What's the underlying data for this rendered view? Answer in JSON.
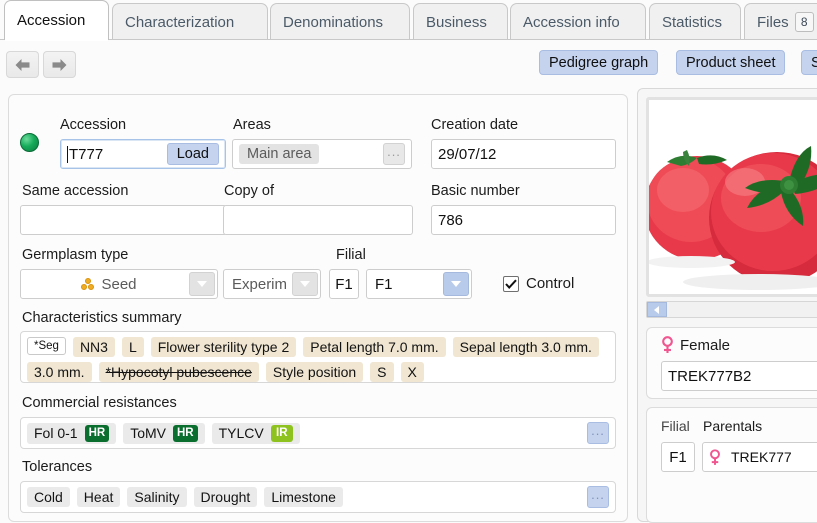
{
  "tabs": [
    {
      "label": "Accession",
      "active": true
    },
    {
      "label": "Characterization",
      "active": false
    },
    {
      "label": "Denominations",
      "active": false
    },
    {
      "label": "Business",
      "active": false
    },
    {
      "label": "Accession info",
      "active": false
    },
    {
      "label": "Statistics",
      "active": false
    },
    {
      "label": "Files",
      "active": false,
      "badge": "8"
    }
  ],
  "actionbar": {
    "back_icon": "arrow-left-icon",
    "forward_icon": "arrow-right-icon",
    "buttons": [
      {
        "label": "Pedigree graph"
      },
      {
        "label": "Product sheet"
      },
      {
        "label": "S"
      }
    ]
  },
  "form": {
    "status_indicator": "green-status-dot",
    "accession_label": "Accession",
    "accession_value": "T777",
    "load_button": "Load",
    "areas_label": "Areas",
    "areas_value": "Main area",
    "areas_browse": "...",
    "creation_date_label": "Creation date",
    "creation_date_value": "29/07/12",
    "same_accession_label": "Same accession",
    "same_accession_value": "",
    "copy_of_label": "Copy of",
    "copy_of_value": "",
    "basic_number_label": "Basic number",
    "basic_number_value": "786",
    "germplasm_type_label": "Germplasm type",
    "germplasm_type_value": "Seed",
    "germplasm_sub_value": "Experim",
    "filial_label": "Filial",
    "filial_code": "F1",
    "filial_value": "F1",
    "control_label": "Control",
    "control_checked": true
  },
  "characteristics": {
    "label": "Characteristics summary",
    "tags": [
      {
        "text": "*Seg",
        "style": "plain"
      },
      {
        "text": "NN3",
        "style": "beige"
      },
      {
        "text": "L",
        "style": "beige"
      },
      {
        "text": "Flower sterility type   2",
        "style": "beige"
      },
      {
        "text": "Petal length  7.0 mm.",
        "style": "beige"
      },
      {
        "text": "Sepal length  3.0 mm.",
        "style": "beige"
      },
      {
        "text": "3.0 mm.",
        "style": "beige"
      },
      {
        "text": "*Hypocotyl pubescence",
        "style": "strike"
      },
      {
        "text": "Style position",
        "style": "beige"
      },
      {
        "text": "S",
        "style": "beige"
      },
      {
        "text": "X",
        "style": "beige"
      }
    ]
  },
  "resistances": {
    "label": "Commercial resistances",
    "browse": "...",
    "items": [
      {
        "name": "Fol 0-1",
        "level": "HR",
        "color": "#0a6e2e"
      },
      {
        "name": "ToMV",
        "level": "HR",
        "color": "#0a6e2e"
      },
      {
        "name": "TYLCV",
        "level": "IR",
        "color": "#8ec31f"
      }
    ]
  },
  "tolerances": {
    "label": "Tolerances",
    "browse": "...",
    "items": [
      "Cold",
      "Heat",
      "Salinity",
      "Drought",
      "Limestone"
    ]
  },
  "rightpanel": {
    "photo_alt": "tomato-photo",
    "scroll_left_icon": "triangle-left-icon",
    "female_icon": "venus-symbol-icon",
    "female_label": "Female",
    "female_value": "TREK777B2",
    "filial_label": "Filial",
    "filial_value": "F1",
    "parentals_label": "Parentals",
    "parental_icon": "venus-symbol-icon",
    "parental_value": "TREK777"
  },
  "colors": {
    "accent_blue": "#c5d3ee",
    "tag_beige": "#f0e6d2",
    "status_green": "#17ab5b",
    "venus_pink": "#f0568f"
  }
}
